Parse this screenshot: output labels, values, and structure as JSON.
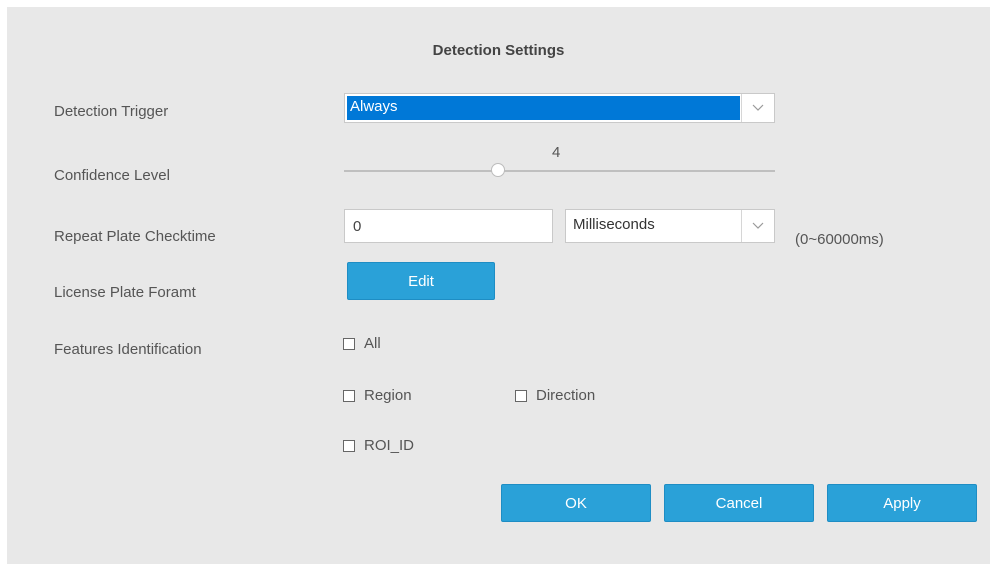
{
  "dialog": {
    "title": "Detection Settings"
  },
  "fields": {
    "detection_trigger": {
      "label": "Detection Trigger",
      "value": "Always"
    },
    "confidence_level": {
      "label": "Confidence Level",
      "value": "4"
    },
    "repeat_plate_checktime": {
      "label": "Repeat Plate Checktime",
      "value": "0",
      "unit": "Milliseconds",
      "range_hint": "(0~60000ms)"
    },
    "license_plate_format": {
      "label": "License Plate Foramt",
      "button_label": "Edit"
    },
    "features_identification": {
      "label": "Features Identification",
      "options": [
        {
          "label": "All",
          "checked": false
        },
        {
          "label": "Region",
          "checked": false
        },
        {
          "label": "Direction",
          "checked": false
        },
        {
          "label": "ROI_ID",
          "checked": false
        }
      ]
    }
  },
  "actions": {
    "ok_label": "OK",
    "cancel_label": "Cancel",
    "apply_label": "Apply"
  },
  "colors": {
    "dialog_background": "#e8e8e8",
    "button_blue": "#2aa1d8",
    "selection_blue": "#0078d7"
  },
  "icons": {
    "dropdown": "chevron-down-icon",
    "checkbox": "checkbox-unchecked-icon"
  }
}
